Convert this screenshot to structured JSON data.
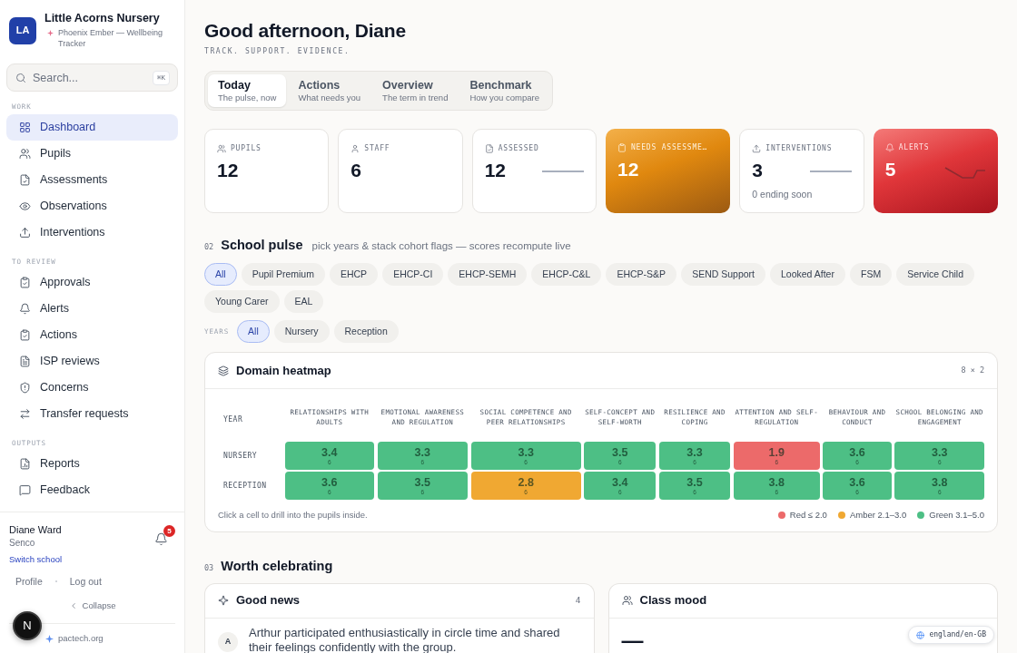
{
  "sidebar": {
    "school": {
      "initials": "LA",
      "name": "Little Acorns Nursery",
      "product": "Phoenix Ember — Wellbeing Tracker"
    },
    "search": {
      "placeholder": "Search...",
      "shortcut": "⌘K"
    },
    "sections": [
      {
        "title": "WORK",
        "items": [
          {
            "label": "Dashboard",
            "selected": true
          },
          {
            "label": "Pupils",
            "selected": false
          },
          {
            "label": "Assessments",
            "selected": false
          },
          {
            "label": "Observations",
            "selected": false
          },
          {
            "label": "Interventions",
            "selected": false
          }
        ]
      },
      {
        "title": "TO REVIEW",
        "items": [
          {
            "label": "Approvals",
            "selected": false
          },
          {
            "label": "Alerts",
            "selected": false
          },
          {
            "label": "Actions",
            "selected": false
          },
          {
            "label": "ISP reviews",
            "selected": false
          },
          {
            "label": "Concerns",
            "selected": false
          },
          {
            "label": "Transfer requests",
            "selected": false
          }
        ]
      },
      {
        "title": "OUTPUTS",
        "items": [
          {
            "label": "Reports",
            "selected": false
          },
          {
            "label": "Feedback",
            "selected": false
          }
        ]
      }
    ],
    "user": {
      "name": "Diane Ward",
      "role": "Senco",
      "switch_link": "Switch school",
      "notification_count": "5"
    },
    "account_links": [
      "Profile",
      "Log out"
    ],
    "collapse": "Collapse",
    "footer_link": "pactech.org"
  },
  "header": {
    "greeting": "Good afternoon, Diane",
    "tagline": "TRACK. SUPPORT. EVIDENCE."
  },
  "tabs": [
    {
      "title": "Today",
      "subtitle": "The pulse, now",
      "selected": true
    },
    {
      "title": "Actions",
      "subtitle": "What needs you",
      "selected": false
    },
    {
      "title": "Overview",
      "subtitle": "The term in trend",
      "selected": false
    },
    {
      "title": "Benchmark",
      "subtitle": "How you compare",
      "selected": false
    }
  ],
  "stats": [
    {
      "kind": "plain",
      "label": "PUPILS",
      "value": "12"
    },
    {
      "kind": "plain",
      "label": "STAFF",
      "value": "6"
    },
    {
      "kind": "plain",
      "label": "ASSESSED",
      "value": "12",
      "trend": {
        "kind": "flat"
      }
    },
    {
      "kind": "warning",
      "label": "NEEDS ASSESSME…",
      "value": "12"
    },
    {
      "kind": "plain",
      "label": "INTERVENTIONS",
      "value": "3",
      "trend": {
        "kind": "flat"
      },
      "note": "0 ending soon"
    },
    {
      "kind": "danger",
      "label": "ALERTS",
      "value": "5",
      "trend": {
        "kind": "dip"
      }
    }
  ],
  "school_pulse": {
    "number": "02",
    "title": "School pulse",
    "hint": "pick years & stack cohort flags — scores recompute live",
    "cohort_flags": [
      {
        "label": "All",
        "selected": true
      },
      {
        "label": "Pupil Premium",
        "selected": false
      },
      {
        "label": "EHCP",
        "selected": false
      },
      {
        "label": "EHCP-CI",
        "selected": false
      },
      {
        "label": "EHCP-SEMH",
        "selected": false
      },
      {
        "label": "EHCP-C&L",
        "selected": false
      },
      {
        "label": "EHCP-S&P",
        "selected": false
      },
      {
        "label": "SEND Support",
        "selected": false
      },
      {
        "label": "Looked After",
        "selected": false
      },
      {
        "label": "FSM",
        "selected": false
      },
      {
        "label": "Service Child",
        "selected": false
      },
      {
        "label": "Young Carer",
        "selected": false
      },
      {
        "label": "EAL",
        "selected": false
      }
    ],
    "years": {
      "label": "YEARS",
      "options": [
        {
          "label": "All",
          "selected": true
        },
        {
          "label": "Nursery",
          "selected": false
        },
        {
          "label": "Reception",
          "selected": false
        }
      ]
    },
    "heatmap": {
      "title": "Domain heatmap",
      "size": "8 × 2",
      "year_header": "YEAR",
      "columns": [
        "RELATIONSHIPS WITH ADULTS",
        "EMOTIONAL AWARENESS AND REGULATION",
        "SOCIAL COMPETENCE AND PEER RELATIONSHIPS",
        "SELF-CONCEPT AND SELF-WORTH",
        "RESILIENCE AND COPING",
        "ATTENTION AND SELF-REGULATION",
        "BEHAVIOUR AND CONDUCT",
        "SCHOOL BELONGING AND ENGAGEMENT"
      ],
      "rows": [
        {
          "year": "NURSERY",
          "cells": [
            {
              "score": "3.4",
              "count": "6",
              "color": "#4dbf85"
            },
            {
              "score": "3.3",
              "count": "6",
              "color": "#4dbf85"
            },
            {
              "score": "3.3",
              "count": "6",
              "color": "#4dbf85"
            },
            {
              "score": "3.5",
              "count": "6",
              "color": "#4dbf85"
            },
            {
              "score": "3.3",
              "count": "6",
              "color": "#4dbf85"
            },
            {
              "score": "1.9",
              "count": "6",
              "color": "#ec6a6a"
            },
            {
              "score": "3.6",
              "count": "6",
              "color": "#4dbf85"
            },
            {
              "score": "3.3",
              "count": "6",
              "color": "#4dbf85"
            }
          ]
        },
        {
          "year": "RECEPTION",
          "cells": [
            {
              "score": "3.6",
              "count": "6",
              "color": "#4dbf85"
            },
            {
              "score": "3.5",
              "count": "6",
              "color": "#4dbf85"
            },
            {
              "score": "2.8",
              "count": "6",
              "color": "#f0a832"
            },
            {
              "score": "3.4",
              "count": "6",
              "color": "#4dbf85"
            },
            {
              "score": "3.5",
              "count": "6",
              "color": "#4dbf85"
            },
            {
              "score": "3.8",
              "count": "6",
              "color": "#4dbf85"
            },
            {
              "score": "3.6",
              "count": "6",
              "color": "#4dbf85"
            },
            {
              "score": "3.8",
              "count": "6",
              "color": "#4dbf85"
            }
          ]
        }
      ],
      "hint": "Click a cell to drill into the pupils inside.",
      "legend": [
        {
          "label": "Red ≤ 2.0",
          "color": "#ec6a6a"
        },
        {
          "label": "Amber 2.1–3.0",
          "color": "#f0a832"
        },
        {
          "label": "Green 3.1–5.0",
          "color": "#4dbf85"
        }
      ]
    }
  },
  "worth_celebrating": {
    "number": "03",
    "title": "Worth celebrating",
    "good_news": {
      "title": "Good news",
      "count": "4",
      "items": [
        {
          "initial": "A",
          "text": "Arthur participated enthusiastically in circle time and shared their feelings confidently with the group."
        }
      ]
    },
    "class_mood": {
      "title": "Class mood",
      "value": "—"
    }
  },
  "locale_badge": "england/en-GB",
  "dev_badge": "N"
}
